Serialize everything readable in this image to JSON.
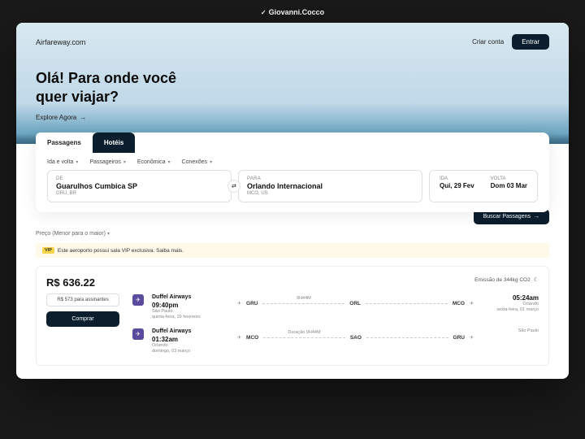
{
  "credit": "Giovanni.Cocco",
  "header": {
    "logo": "Airfareway.com",
    "create_account": "Criar conta",
    "login": "Entrar"
  },
  "hero": {
    "title_line1": "Olá! Para onde você",
    "title_line2": "quer viajar?",
    "explore": "Explore Agora"
  },
  "tabs": {
    "flights": "Passagens",
    "hotels": "Hotéis"
  },
  "filters": {
    "trip": "Ida e volta",
    "pax": "Passageiros",
    "class": "Econômica",
    "conn": "Conexões"
  },
  "from": {
    "label": "DE",
    "value": "Guarulhos Cumbica SP",
    "code": "GRU, BR"
  },
  "to": {
    "label": "PARA",
    "value": "Orlando Internacional",
    "code": "MCO, US"
  },
  "dates": {
    "out_label": "IDA",
    "out_value": "Qui, 29 Fev",
    "ret_label": "VOLTA",
    "ret_value": "Dom 03 Mar"
  },
  "search_btn": "Buscar Passagens",
  "sort": "Preço (Menor para o maior)",
  "vip": {
    "badge": "VIP",
    "text": "Este aeroporto possui sala VIP exclusiva. Saiba mais."
  },
  "price": {
    "amount": "R$ 636.22",
    "subscriber": "R$ 573 para assinantes",
    "buy": "Comprar"
  },
  "co2": "Emissão de 344kg CO2",
  "leg1": {
    "airline": "Duffel Airways",
    "dep_time": "09:40pm",
    "dep_city": "São Paulo",
    "dep_date": "quinta-feira, 29 fevereiro",
    "a1": "GRU",
    "mid": "ORL",
    "a2": "MCO",
    "duration": "9H44M",
    "arr_time": "05:24am",
    "arr_city": "Orlando",
    "arr_date": "sexta-feira, 01 março"
  },
  "leg2": {
    "airline": "Duffel Airways",
    "dep_time": "01:32am",
    "dep_city": "Orlando",
    "dep_date": "domingo, 03 março",
    "a1": "MCO",
    "mid": "SAO",
    "a2": "GRU",
    "duration": "Duração 9H44M",
    "arr_city": "São Paulo"
  }
}
